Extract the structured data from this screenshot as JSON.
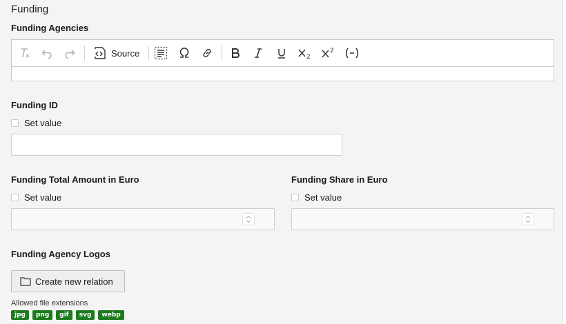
{
  "section": {
    "title": "Funding"
  },
  "agencies": {
    "label": "Funding Agencies",
    "toolbar": {
      "source_label": "Source"
    }
  },
  "funding_id": {
    "label": "Funding ID",
    "set_value_label": "Set value"
  },
  "total_amount": {
    "label": "Funding Total Amount in Euro",
    "set_value_label": "Set value"
  },
  "share": {
    "label": "Funding Share in Euro",
    "set_value_label": "Set value"
  },
  "logos": {
    "label": "Funding Agency Logos",
    "create_button_label": "Create new relation",
    "allowed_label": "Allowed file extensions",
    "extensions": [
      "jpg",
      "png",
      "gif",
      "svg",
      "webp"
    ],
    "badge_color": "#1e7a1e"
  }
}
